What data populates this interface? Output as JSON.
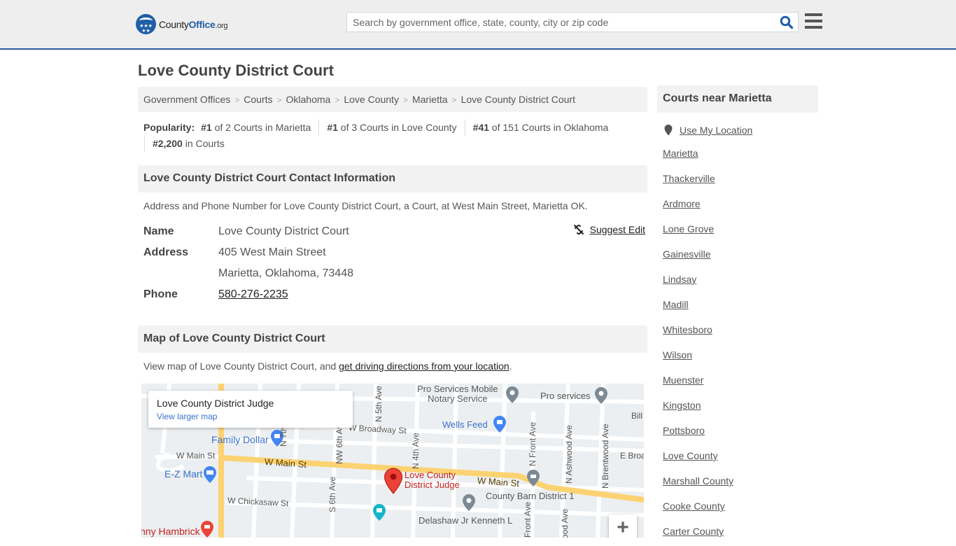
{
  "header": {
    "logo": {
      "name_part1": "County",
      "name_part2": "Office",
      "tld": ".org",
      "badge_stars": "★★★\n★★"
    },
    "search": {
      "placeholder": "Search by government office, state, county, city or zip code",
      "value": ""
    },
    "search_icon": "search-icon",
    "menu_icon": "hamburger-menu-icon"
  },
  "page": {
    "title": "Love County District Court",
    "breadcrumb": [
      {
        "label": "Government Offices"
      },
      {
        "label": "Courts"
      },
      {
        "label": "Oklahoma"
      },
      {
        "label": "Love County"
      },
      {
        "label": "Marietta"
      },
      {
        "label": "Love County District Court"
      }
    ],
    "breadcrumb_separator": ">",
    "popularity": {
      "label": "Popularity:",
      "items": [
        {
          "rank": "#1",
          "text": " of 2 Courts in Marietta"
        },
        {
          "rank": "#1",
          "text": " of 3 Courts in Love County"
        },
        {
          "rank": "#41",
          "text": " of 151 Courts in Oklahoma"
        },
        {
          "rank": "#2,200",
          "text": " in Courts"
        }
      ]
    }
  },
  "contact": {
    "heading": "Love County District Court Contact Information",
    "description": "Address and Phone Number for Love County District Court, a Court, at West Main Street, Marietta OK.",
    "suggest_edit": "Suggest Edit",
    "fields": {
      "name_label": "Name",
      "name_value": "Love County District Court",
      "address_label": "Address",
      "address_line1": "405 West Main Street",
      "address_line2": "Marietta, Oklahoma, 73448",
      "phone_label": "Phone",
      "phone_value": "580-276-2235"
    }
  },
  "map_section": {
    "heading": "Map of Love County District Court",
    "desc_prefix": "View map of Love County District Court, and ",
    "desc_link": "get driving directions from your location",
    "desc_suffix": ".",
    "map": {
      "card_title": "Love County District Judge",
      "card_link": "View larger map",
      "zoom_in": "+",
      "labels": {
        "family_dollar": "Family Dollar",
        "w_main_st_left": "W Main St",
        "w_main_st": "W Main St",
        "w_main_st_right": "W Main St",
        "ez_mart": "E-Z Mart",
        "w_chickasaw": "W Chickasaw St",
        "hambrick": "nny Hambrick",
        "w_broadway": "W Broadway St",
        "n_7th": "N 7th Ave",
        "nw_6th": "NW 6th Ave",
        "s_6th": "S 6th Ave",
        "n_5th": "N 5th Ave",
        "n_4th": "N 4th Ave",
        "pro_mobile_1": "Pro Services Mobile",
        "pro_mobile_2": "Notary Service",
        "pro_services": "Pro services",
        "wells_feed": "Wells Feed",
        "bill": "Bill",
        "n_front": "N Front Ave",
        "front_bottom": "Front Ave",
        "n_ashwood": "N Ashwood Ave",
        "ashwood_bottom": "ood Ave",
        "n_brentwood": "N Brentwood Ave",
        "e_broadway": "E Broa",
        "marker_1": "Love County",
        "marker_2": "District Judge",
        "county_barn": "County Barn District 1",
        "delashaw": "Delashaw Jr Kenneth L"
      }
    }
  },
  "sidebar": {
    "heading": "Courts near Marietta",
    "use_location": "Use My Location",
    "links": [
      "Marietta",
      "Thackerville",
      "Ardmore",
      "Lone Grove",
      "Gainesville",
      "Lindsay",
      "Madill",
      "Whitesboro",
      "Wilson",
      "Muenster",
      "Kingston",
      "Pottsboro",
      "Love County",
      "Marshall County",
      "Cooke County",
      "Carter County"
    ]
  },
  "colors": {
    "brand_blue": "#1f5ea8",
    "header_bg": "#eeeeee",
    "panel_bg": "#f2f2f2",
    "map_road_major": "#fcd272",
    "map_marker": "#ea4335",
    "map_link": "#3a72c9"
  }
}
